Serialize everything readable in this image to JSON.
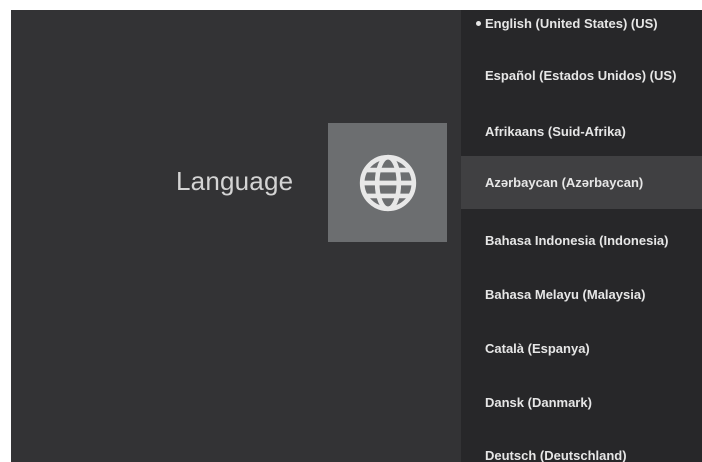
{
  "page": {
    "title": "Language"
  },
  "icon": {
    "name": "globe-icon"
  },
  "languages": {
    "selected_index": 0,
    "focused_index": 3,
    "items": [
      {
        "label": "English (United States) (US)"
      },
      {
        "label": "Español (Estados Unidos) (US)"
      },
      {
        "label": "Afrikaans (Suid-Afrika)"
      },
      {
        "label": "Azərbaycan (Azərbaycan)"
      },
      {
        "label": "Bahasa Indonesia (Indonesia)"
      },
      {
        "label": "Bahasa Melayu (Malaysia)"
      },
      {
        "label": "Català (Espanya)"
      },
      {
        "label": "Dansk (Danmark)"
      },
      {
        "label": "Deutsch (Deutschland)"
      }
    ]
  },
  "colors": {
    "background": "#333335",
    "list_background": "#272729",
    "focus_highlight": "#404042",
    "icon_tile": "#6c6e70",
    "text": "#e6e6e6"
  }
}
